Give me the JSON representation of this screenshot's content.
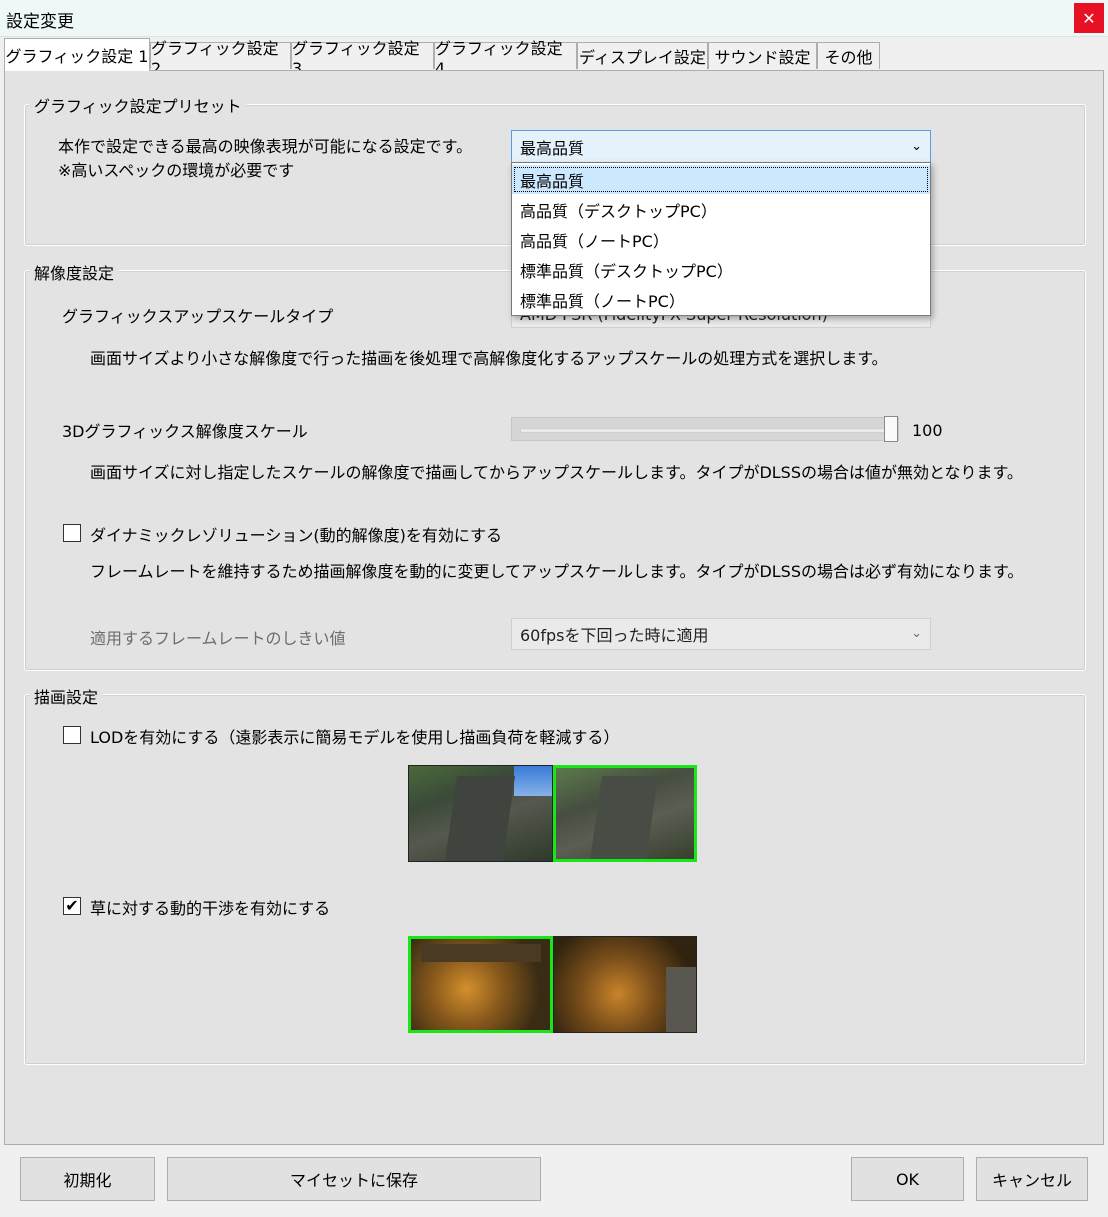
{
  "window": {
    "title": "設定変更",
    "close_glyph": "✕"
  },
  "tabs": [
    {
      "label": "グラフィック設定 1",
      "active": true
    },
    {
      "label": "グラフィック設定 2"
    },
    {
      "label": "グラフィック設定 3"
    },
    {
      "label": "グラフィック設定 4"
    },
    {
      "label": "ディスプレイ設定"
    },
    {
      "label": "サウンド設定"
    },
    {
      "label": "その他"
    }
  ],
  "preset": {
    "group_title": "グラフィック設定プリセット",
    "description_line1": "本作で設定できる最高の映像表現が可能になる設定です。",
    "description_line2": "※高いスペックの環境が必要です",
    "selected": "最高品質",
    "options": [
      "最高品質",
      "高品質（デスクトップPC）",
      "高品質（ノートPC）",
      "標準品質（デスクトップPC）",
      "標準品質（ノートPC）"
    ]
  },
  "resolution": {
    "group_title": "解像度設定",
    "upscale_label": "グラフィックスアップスケールタイプ",
    "upscale_value": "AMD FSR (FidelityFX Super Resolution)",
    "upscale_desc": "画面サイズより小さな解像度で行った描画を後処理で高解像度化するアップスケールの処理方式を選択します。",
    "scale_label": "3Dグラフィックス解像度スケール",
    "scale_value": "100",
    "scale_level_percent": 100,
    "scale_desc": "画面サイズに対し指定したスケールの解像度で描画してからアップスケールします。タイプがDLSSの場合は値が無効となります。",
    "dynamic_label": "ダイナミックレゾリューション(動的解像度)を有効にする",
    "dynamic_checked": false,
    "dynamic_desc": "フレームレートを維持するため描画解像度を動的に変更してアップスケールします。タイプがDLSSの場合は必ず有効になります。",
    "threshold_label": "適用するフレームレートのしきい値",
    "threshold_value": "60fpsを下回った時に適用"
  },
  "render": {
    "group_title": "描画設定",
    "lod_label": "LODを有効にする（遠影表示に簡易モデルを使用し描画負荷を軽減する）",
    "lod_checked": false,
    "grass_label": "草に対する動的干渉を有効にする",
    "grass_checked": true,
    "check_glyph": "✔"
  },
  "buttons": {
    "reset": "初期化",
    "save_myset": "マイセットに保存",
    "ok": "OK",
    "cancel": "キャンセル"
  },
  "colors": {
    "highlight_border": "#19e619",
    "close_red": "#e81123",
    "selection": "#cce8ff"
  }
}
